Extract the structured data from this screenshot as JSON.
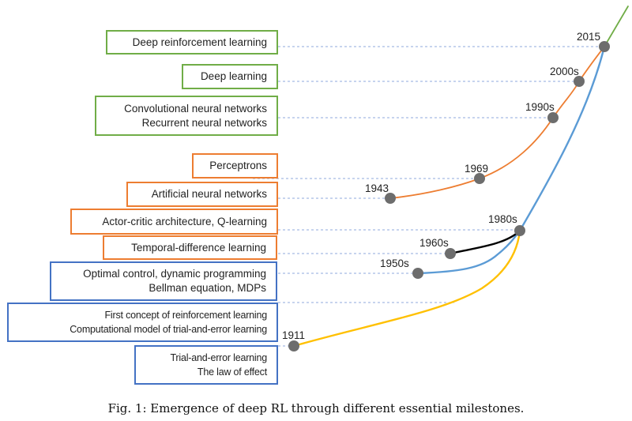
{
  "figure": {
    "caption": "Fig. 1: Emergence of deep RL through different essential milestones.",
    "colors": {
      "deep_rl": "#70ad47",
      "neural_networks": "#ed7d31",
      "rl_theory": "#5b9bd5",
      "trial_error": "#ffc000",
      "td_learning": "#000000",
      "milestone_dot": "#6d6d6d",
      "dashed_guide": "#8faadc"
    },
    "boxes": [
      {
        "id": "deep-rl",
        "lines": [
          "Deep reinforcement learning"
        ],
        "category": "green"
      },
      {
        "id": "deep-learning",
        "lines": [
          "Deep learning"
        ],
        "category": "green"
      },
      {
        "id": "cnn-rnn",
        "lines": [
          "Convolutional neural networks",
          "Recurrent neural networks"
        ],
        "category": "green"
      },
      {
        "id": "perceptrons",
        "lines": [
          "Perceptrons"
        ],
        "category": "orange"
      },
      {
        "id": "ann",
        "lines": [
          "Artificial neural networks"
        ],
        "category": "orange"
      },
      {
        "id": "actor-critic",
        "lines": [
          "Actor-critic architecture, Q-learning"
        ],
        "category": "orange"
      },
      {
        "id": "td",
        "lines": [
          "Temporal-difference learning"
        ],
        "category": "orange"
      },
      {
        "id": "optimal-control",
        "lines": [
          "Optimal control, dynamic programming",
          "Bellman equation, MDPs"
        ],
        "category": "blue"
      },
      {
        "id": "first-concept",
        "lines": [
          "First concept of reinforcement learning",
          "Computational model of trial-and-error learning"
        ],
        "category": "blue"
      },
      {
        "id": "trial-error",
        "lines": [
          "Trial-and-error learning",
          "The law of effect"
        ],
        "category": "blue"
      }
    ],
    "milestones": [
      {
        "label": "2015",
        "box": "deep-rl"
      },
      {
        "label": "2000s",
        "box": "deep-learning"
      },
      {
        "label": "1990s",
        "box": "cnn-rnn"
      },
      {
        "label": "1969",
        "box": "perceptrons"
      },
      {
        "label": "1943",
        "box": "ann"
      },
      {
        "label": "1980s",
        "box": "actor-critic"
      },
      {
        "label": "1960s",
        "box": "td"
      },
      {
        "label": "1950s",
        "box": "optimal-control"
      },
      {
        "label": "1911",
        "box": "trial-error"
      }
    ]
  }
}
